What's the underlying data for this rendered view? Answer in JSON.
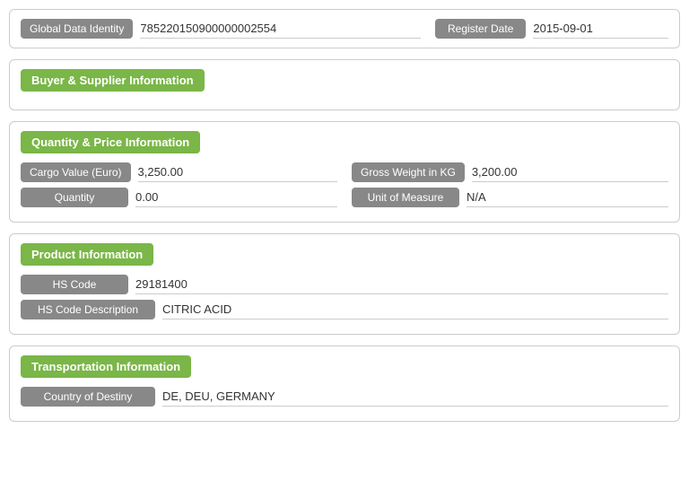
{
  "header": {
    "global_data_identity_label": "Global Data Identity",
    "global_data_identity_value": "785220150900000002554",
    "register_date_label": "Register Date",
    "register_date_value": "2015-09-01"
  },
  "buyer_supplier": {
    "section_title": "Buyer & Supplier Information"
  },
  "quantity_price": {
    "section_title": "Quantity & Price Information",
    "cargo_value_label": "Cargo Value (Euro)",
    "cargo_value": "3,250.00",
    "gross_weight_label": "Gross Weight in KG",
    "gross_weight": "3,200.00",
    "quantity_label": "Quantity",
    "quantity_value": "0.00",
    "unit_of_measure_label": "Unit of Measure",
    "unit_of_measure_value": "N/A"
  },
  "product": {
    "section_title": "Product Information",
    "hs_code_label": "HS Code",
    "hs_code_value": "29181400",
    "hs_code_desc_label": "HS Code Description",
    "hs_code_desc_value": "CITRIC ACID"
  },
  "transportation": {
    "section_title": "Transportation Information",
    "country_of_destiny_label": "Country of Destiny",
    "country_of_destiny_value": "DE, DEU, GERMANY"
  }
}
